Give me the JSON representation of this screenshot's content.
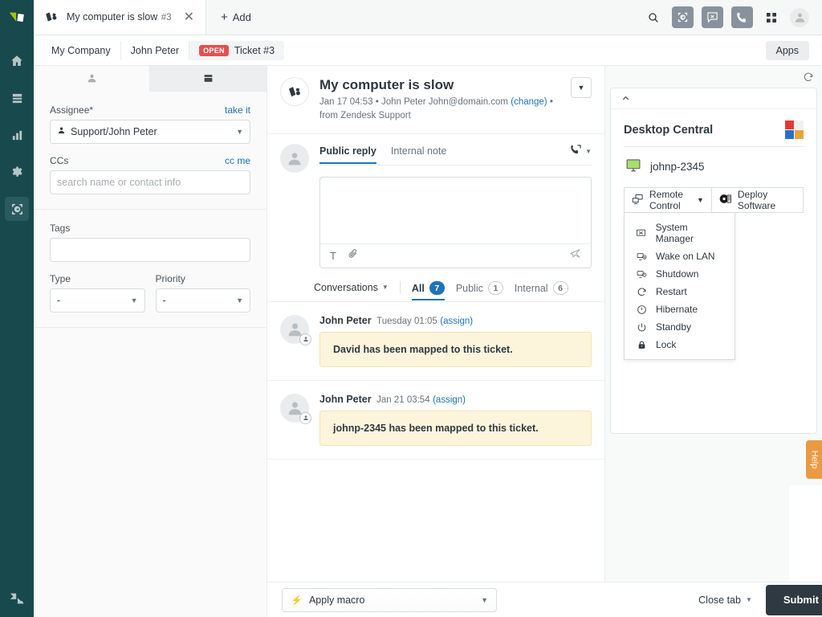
{
  "rail": {
    "logo_icon": "zendesk-product-mark",
    "items": [
      {
        "name": "home",
        "icon": "home-icon",
        "active": false
      },
      {
        "name": "views",
        "icon": "views-list-icon",
        "active": false
      },
      {
        "name": "reporting",
        "icon": "bar-chart-icon",
        "active": false
      },
      {
        "name": "admin",
        "icon": "gear-icon",
        "active": false
      },
      {
        "name": "desktop-central-app",
        "icon": "desktop-central-icon",
        "active": true
      }
    ],
    "footer_icon": "zendesk-logo"
  },
  "topbar": {
    "tab": {
      "title": "My computer is slow",
      "subtitle": "#3",
      "icon": "ticket-icon",
      "close_icon": "close-icon"
    },
    "add_label": "Add",
    "add_icon": "plus-icon",
    "actions": [
      {
        "name": "search",
        "icon": "search-icon"
      },
      {
        "name": "desktop-central",
        "icon": "desktop-central-icon"
      },
      {
        "name": "chat",
        "icon": "chat-x-icon"
      },
      {
        "name": "talk",
        "icon": "phone-icon"
      },
      {
        "name": "products",
        "icon": "grid-icon"
      },
      {
        "name": "user-menu",
        "icon": "avatar-icon"
      }
    ]
  },
  "breadcrumb": {
    "items": [
      "My Company",
      "John Peter"
    ],
    "current": {
      "status": "OPEN",
      "label": "Ticket #3"
    },
    "apps_label": "Apps"
  },
  "properties": {
    "tabs": [
      {
        "name": "user-tab",
        "icon": "person-icon",
        "selected": true
      },
      {
        "name": "apps-tab",
        "icon": "panels-icon",
        "selected": false
      }
    ],
    "assignee": {
      "label": "Assignee*",
      "action": "take it",
      "value": "Support/John Peter",
      "icon": "assignee-icon"
    },
    "ccs": {
      "label": "CCs",
      "action": "cc me",
      "placeholder": "search name or contact info",
      "value": ""
    },
    "tags": {
      "label": "Tags",
      "value": ""
    },
    "type": {
      "label": "Type",
      "value": "-"
    },
    "priority": {
      "label": "Priority",
      "value": "-"
    }
  },
  "ticket": {
    "avatar_icon": "ticket-icon",
    "title": "My computer is slow",
    "meta_date": "Jan 17 04:53",
    "meta_sep": "•",
    "meta_user": "John Peter John@domain.com",
    "meta_change": "(change)",
    "meta_channel": "from Zendesk Support",
    "options_icon": "chevron-down-icon",
    "composer": {
      "tabs": [
        {
          "label": "Public reply",
          "active": true
        },
        {
          "label": "Internal note",
          "active": false
        }
      ],
      "call_icon": "phone-forward-icon",
      "call_chevron": "chevron-down-icon",
      "body": "",
      "toolbar": [
        {
          "name": "text-format",
          "icon": "text-format-icon",
          "glyph": "T"
        },
        {
          "name": "attach-file",
          "icon": "paperclip-icon"
        }
      ],
      "send_icon": "send-icon"
    },
    "conversations": {
      "label": "Conversations",
      "chevron": "chevron-down-icon",
      "filters": [
        {
          "label": "All",
          "count": "7",
          "active": true
        },
        {
          "label": "Public",
          "count": "1",
          "active": false
        },
        {
          "label": "Internal",
          "count": "6",
          "active": false
        }
      ]
    },
    "events": [
      {
        "author": "John Peter",
        "time": "Tuesday 01:05",
        "action": "(assign)",
        "text": "David has been mapped to this ticket.",
        "avatar_icon": "avatar-icon",
        "badge_icon": "agent-badge-icon"
      },
      {
        "author": "John Peter",
        "time": "Jan 21 03:54",
        "action": "(assign)",
        "text": "johnp-2345 has been mapped to this ticket.",
        "avatar_icon": "avatar-icon",
        "badge_icon": "agent-badge-icon"
      }
    ]
  },
  "apps_panel": {
    "refresh_icon": "refresh-icon",
    "collapse_icon": "chevron-up-icon",
    "app": {
      "title": "Desktop Central",
      "logo_icon": "desktop-central-logo",
      "host": {
        "name": "johnp-2345",
        "status_icon": "monitor-online-icon"
      },
      "buttons": [
        {
          "label": "Remote Control",
          "icon": "remote-control-icon",
          "chevron": "chevron-down-icon"
        },
        {
          "label": "Deploy Software",
          "icon": "disc-icon"
        }
      ],
      "menu": [
        {
          "label": "System Manager",
          "icon": "system-manager-icon"
        },
        {
          "label": "Wake on LAN",
          "icon": "wake-on-lan-icon"
        },
        {
          "label": "Shutdown",
          "icon": "shutdown-icon"
        },
        {
          "label": "Restart",
          "icon": "restart-icon"
        },
        {
          "label": "Hibernate",
          "icon": "hibernate-icon"
        },
        {
          "label": "Standby",
          "icon": "standby-icon"
        },
        {
          "label": "Lock",
          "icon": "lock-icon"
        }
      ]
    }
  },
  "help_tab": {
    "label": "Help"
  },
  "footer": {
    "macro_label": "Apply macro",
    "macro_icon": "lightning-icon",
    "macro_chevron": "chevron-down-icon",
    "close_tab_label": "Close tab",
    "close_tab_chevron": "chevron-down-icon",
    "submit_label": "Submit as"
  },
  "colors": {
    "rail_bg": "#17494d",
    "accent_blue": "#1f73b7",
    "open_red": "#e34f4f",
    "note_yellow": "#fdf4dc",
    "submit_dark": "#2f3941",
    "help_orange": "#eb9a44"
  }
}
